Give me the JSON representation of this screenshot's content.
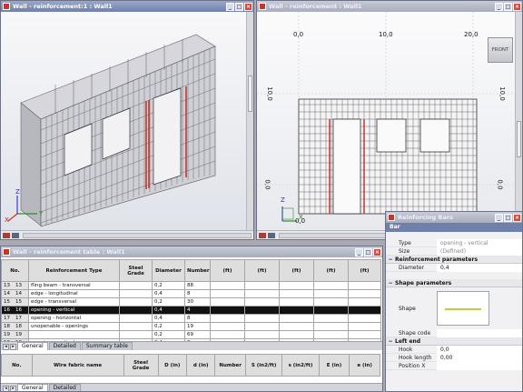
{
  "win3d": {
    "title": "Wall - reinforcement:1 : Wall1"
  },
  "win2d": {
    "title": "Wall - reinforcement : Wall1",
    "top_ticks": [
      "0,0",
      "10,0",
      "20,0"
    ],
    "side_ticks": [
      "10,0",
      "0,0"
    ],
    "bottom_tick": "0,0",
    "front_label": "FRONT",
    "axis_x": "X",
    "axis_z": "Z"
  },
  "axes3d": {
    "x": "X",
    "y": "Y",
    "z": "Z"
  },
  "table": {
    "title": "Wall - reinforcement table : Wall1",
    "columns": [
      "No.",
      "Reinforcement Type",
      "Steel Grade",
      "Diameter",
      "Number",
      "(ft)",
      "(ft)",
      "(ft)",
      "(ft)",
      "(ft)"
    ],
    "rows": [
      {
        "no": "13",
        "idx": "13",
        "type": "fling beam - transversal",
        "grade": "",
        "dia": "0,2",
        "num": "88"
      },
      {
        "no": "14",
        "idx": "14",
        "type": "edge - longitudinal",
        "grade": "",
        "dia": "0,4",
        "num": "8"
      },
      {
        "no": "15",
        "idx": "15",
        "type": "edge - transversal",
        "grade": "",
        "dia": "0,2",
        "num": "30"
      },
      {
        "no": "16",
        "idx": "16",
        "type": "opening - vertical",
        "grade": "",
        "dia": "0,4",
        "num": "4"
      },
      {
        "no": "17",
        "idx": "17",
        "type": "opening - horizontal",
        "grade": "",
        "dia": "0,4",
        "num": "8"
      },
      {
        "no": "18",
        "idx": "18",
        "type": "unopenable - openings",
        "grade": "",
        "dia": "0,2",
        "num": "19"
      },
      {
        "no": "19",
        "idx": "19",
        "type": "",
        "grade": "",
        "dia": "0,2",
        "num": "69"
      },
      {
        "no": "19",
        "idx": "19",
        "type": "opening - vertical",
        "grade": "",
        "dia": "0,4",
        "num": "8"
      }
    ],
    "tabs": [
      "General",
      "Detailed",
      "Summary table"
    ]
  },
  "table2": {
    "columns": [
      "No.",
      "Wire fabric name",
      "Steel Grade",
      "D (in)",
      "d (in)",
      "Number",
      "S (in2/ft)",
      "s (in2/ft)",
      "E (in)",
      "e (in)"
    ],
    "tabs": [
      "General",
      "Detailed"
    ]
  },
  "props": {
    "title": "Reinforcing Bars",
    "header": "Bar",
    "rows_top": [
      {
        "k": "Type",
        "v": "opening - vertical"
      },
      {
        "k": "Size",
        "v": "(Defined)"
      }
    ],
    "sec_reinf": "Reinforcement parameters",
    "diameter": {
      "k": "Diameter",
      "v": "0,4"
    },
    "sec_shape": "Shape parameters",
    "shape_label": "Shape",
    "shape_code": "Shape code",
    "sec_left": "Left end",
    "rows_left": [
      {
        "k": "Hook",
        "v": "0,0"
      },
      {
        "k": "Hook length",
        "v": "0,00"
      },
      {
        "k": "Position X",
        "v": ""
      }
    ]
  },
  "colors": {
    "titlebar": "#7384ab",
    "rebar": "#707070",
    "highlight": "#c8352d",
    "selection": "#111111"
  }
}
